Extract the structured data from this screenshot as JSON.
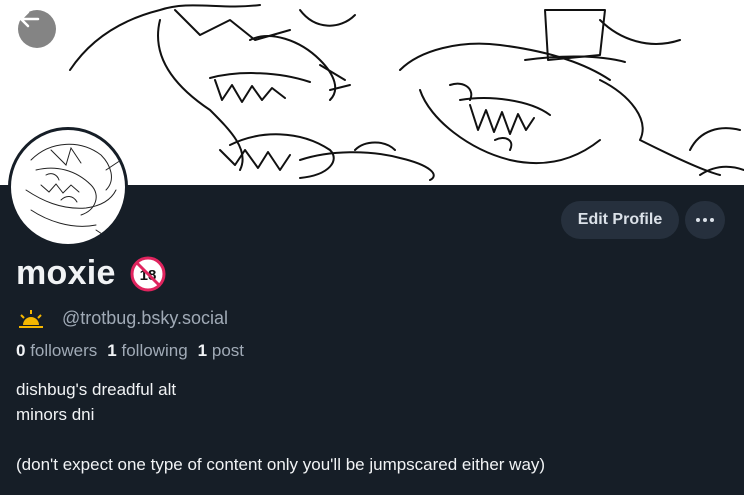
{
  "profile": {
    "display_name": "moxie",
    "handle": "@trotbug.bsky.social",
    "followers_count": "0",
    "followers_label": "followers",
    "following_count": "1",
    "following_label": "following",
    "posts_count": "1",
    "posts_label": "post",
    "bio_lines": [
      "dishbug's dreadful alt",
      "minors dni",
      "",
      "(don't expect one type of content only you'll be jumpscared either way)"
    ]
  },
  "actions": {
    "edit_profile_label": "Edit Profile"
  },
  "icons": {
    "back": "arrow-left-icon",
    "more": "ellipsis-icon",
    "nsfw": "no-under-18-icon",
    "handle_badge": "sun-icon"
  },
  "colors": {
    "background": "#161e27",
    "button_bg": "#26303d",
    "muted_text": "#a0aab6",
    "nsfw_red": "#e0245e"
  }
}
